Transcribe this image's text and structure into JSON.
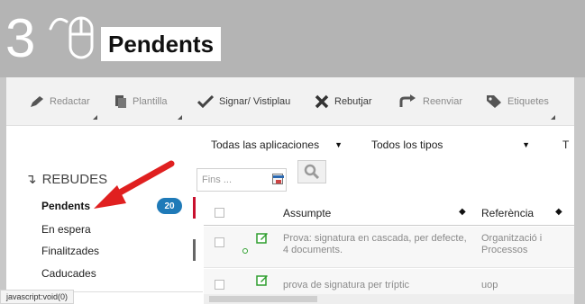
{
  "banner": {
    "step_number": "3",
    "title": "Pendents",
    "icon": "mouse-click-icon"
  },
  "toolbar": {
    "items": [
      {
        "label": "Redactar",
        "icon": "pencil-icon"
      },
      {
        "label": "Plantilla",
        "icon": "copy-icon"
      },
      {
        "label": "Signar/ Vistiplau",
        "icon": "checkmark-icon"
      },
      {
        "label": "Rebutjar",
        "icon": "x-icon"
      },
      {
        "label": "Reenviar",
        "icon": "forward-icon"
      },
      {
        "label": "Etiquetes",
        "icon": "tag-icon"
      }
    ]
  },
  "filters": {
    "applications": "Todas las aplicaciones",
    "types": "Todos los tipos",
    "third": "T",
    "date_placeholder": "Fins ...",
    "calendar_icon": "calendar-icon",
    "search_icon": "search-icon"
  },
  "sidebar": {
    "section_title": "REBUDES",
    "items": [
      {
        "label": "Pendents",
        "badge": "20",
        "active": true
      },
      {
        "label": "En espera"
      },
      {
        "label": "Finalitzades"
      },
      {
        "label": "Caducades"
      }
    ]
  },
  "table": {
    "columns": [
      {
        "label": "Assumpte"
      },
      {
        "label": "Referència"
      }
    ],
    "rows": [
      {
        "subject": "Prova: signatura en cascada, per defecte, 4 documents.",
        "reference": "Organització i Processos"
      },
      {
        "subject": "prova de signatura per tríptic",
        "reference": "uop"
      }
    ]
  },
  "status_bar": "javascript:void(0)",
  "colors": {
    "banner_bg": "#b4b4b4",
    "badge": "#1f7ab8",
    "active_marker": "#c8102e",
    "annotation_arrow": "#e02020",
    "edit_icon": "#2e9e2e"
  }
}
